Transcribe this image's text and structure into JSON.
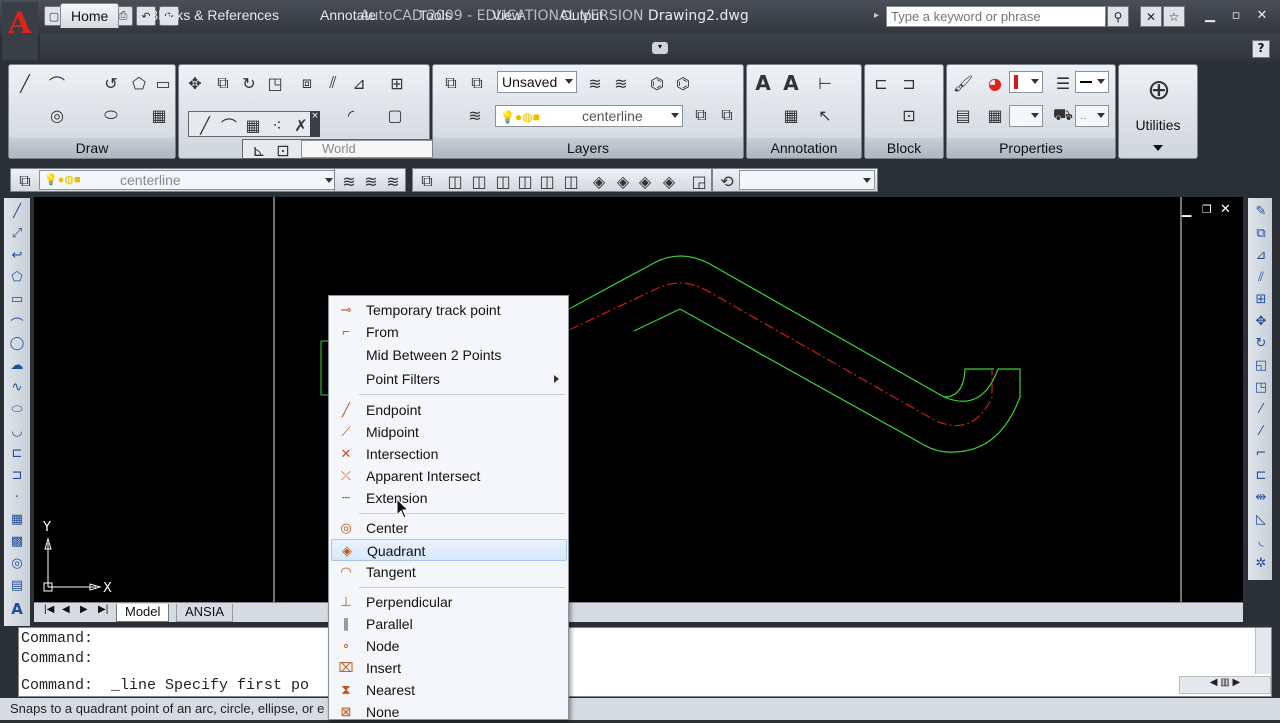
{
  "window": {
    "title_prefix": "AutoCAD 2009 - EDUCATIONAL VERSION ",
    "title_doc": "Drawing2.dwg"
  },
  "search": {
    "placeholder": "Type a keyword or phrase"
  },
  "tabs": [
    {
      "label": "Home"
    },
    {
      "label": "Blocks & References"
    },
    {
      "label": "Annotate"
    },
    {
      "label": "Tools"
    },
    {
      "label": "View"
    },
    {
      "label": "Output"
    }
  ],
  "panels": {
    "draw": "Draw",
    "layers": "Layers",
    "annotation": "Annotation",
    "block": "Block",
    "properties": "Properties",
    "utilities": "Utilities"
  },
  "combos": {
    "layer_state": "Unsaved",
    "layer_current": "centerline",
    "ucs": "World",
    "layer_toolbar": "centerline",
    "props_bylayer": ".."
  },
  "layout_tabs": [
    {
      "label": "Model"
    },
    {
      "label": "ANSIA"
    }
  ],
  "axis": {
    "x": "X",
    "y": "Y"
  },
  "command": {
    "lines": [
      "Command:",
      "Command:",
      "Command:  _line Specify first po"
    ]
  },
  "status": "Snaps to a quadrant point of an arc, circle, ellipse, or e",
  "context_menu": {
    "items": [
      {
        "label": "Temporary track point",
        "icon": "track-icon"
      },
      {
        "label": "From",
        "icon": "from-icon"
      },
      {
        "label": "Mid Between 2 Points",
        "icon": ""
      },
      {
        "label": "Point Filters",
        "icon": "",
        "submenu": true
      },
      {
        "label": "Endpoint",
        "icon": "endpoint-icon"
      },
      {
        "label": "Midpoint",
        "icon": "midpoint-icon"
      },
      {
        "label": "Intersection",
        "icon": "intersection-icon"
      },
      {
        "label": "Apparent Intersect",
        "icon": "apparent-intersect-icon"
      },
      {
        "label": "Extension",
        "icon": "extension-icon"
      },
      {
        "label": "Center",
        "icon": "center-icon"
      },
      {
        "label": "Quadrant",
        "icon": "quadrant-icon",
        "highlighted": true
      },
      {
        "label": "Tangent",
        "icon": "tangent-icon"
      },
      {
        "label": "Perpendicular",
        "icon": "perpendicular-icon"
      },
      {
        "label": "Parallel",
        "icon": "parallel-icon"
      },
      {
        "label": "Node",
        "icon": "node-icon"
      },
      {
        "label": "Insert",
        "icon": "insert-icon"
      },
      {
        "label": "Nearest",
        "icon": "nearest-icon"
      },
      {
        "label": "None",
        "icon": "none-icon"
      }
    ]
  },
  "colors": {
    "accent_red": "#e0231b",
    "drawing_green": "#3ad23a",
    "centerline_red": "#d21a1a",
    "highlight": "#d6e8f8"
  }
}
